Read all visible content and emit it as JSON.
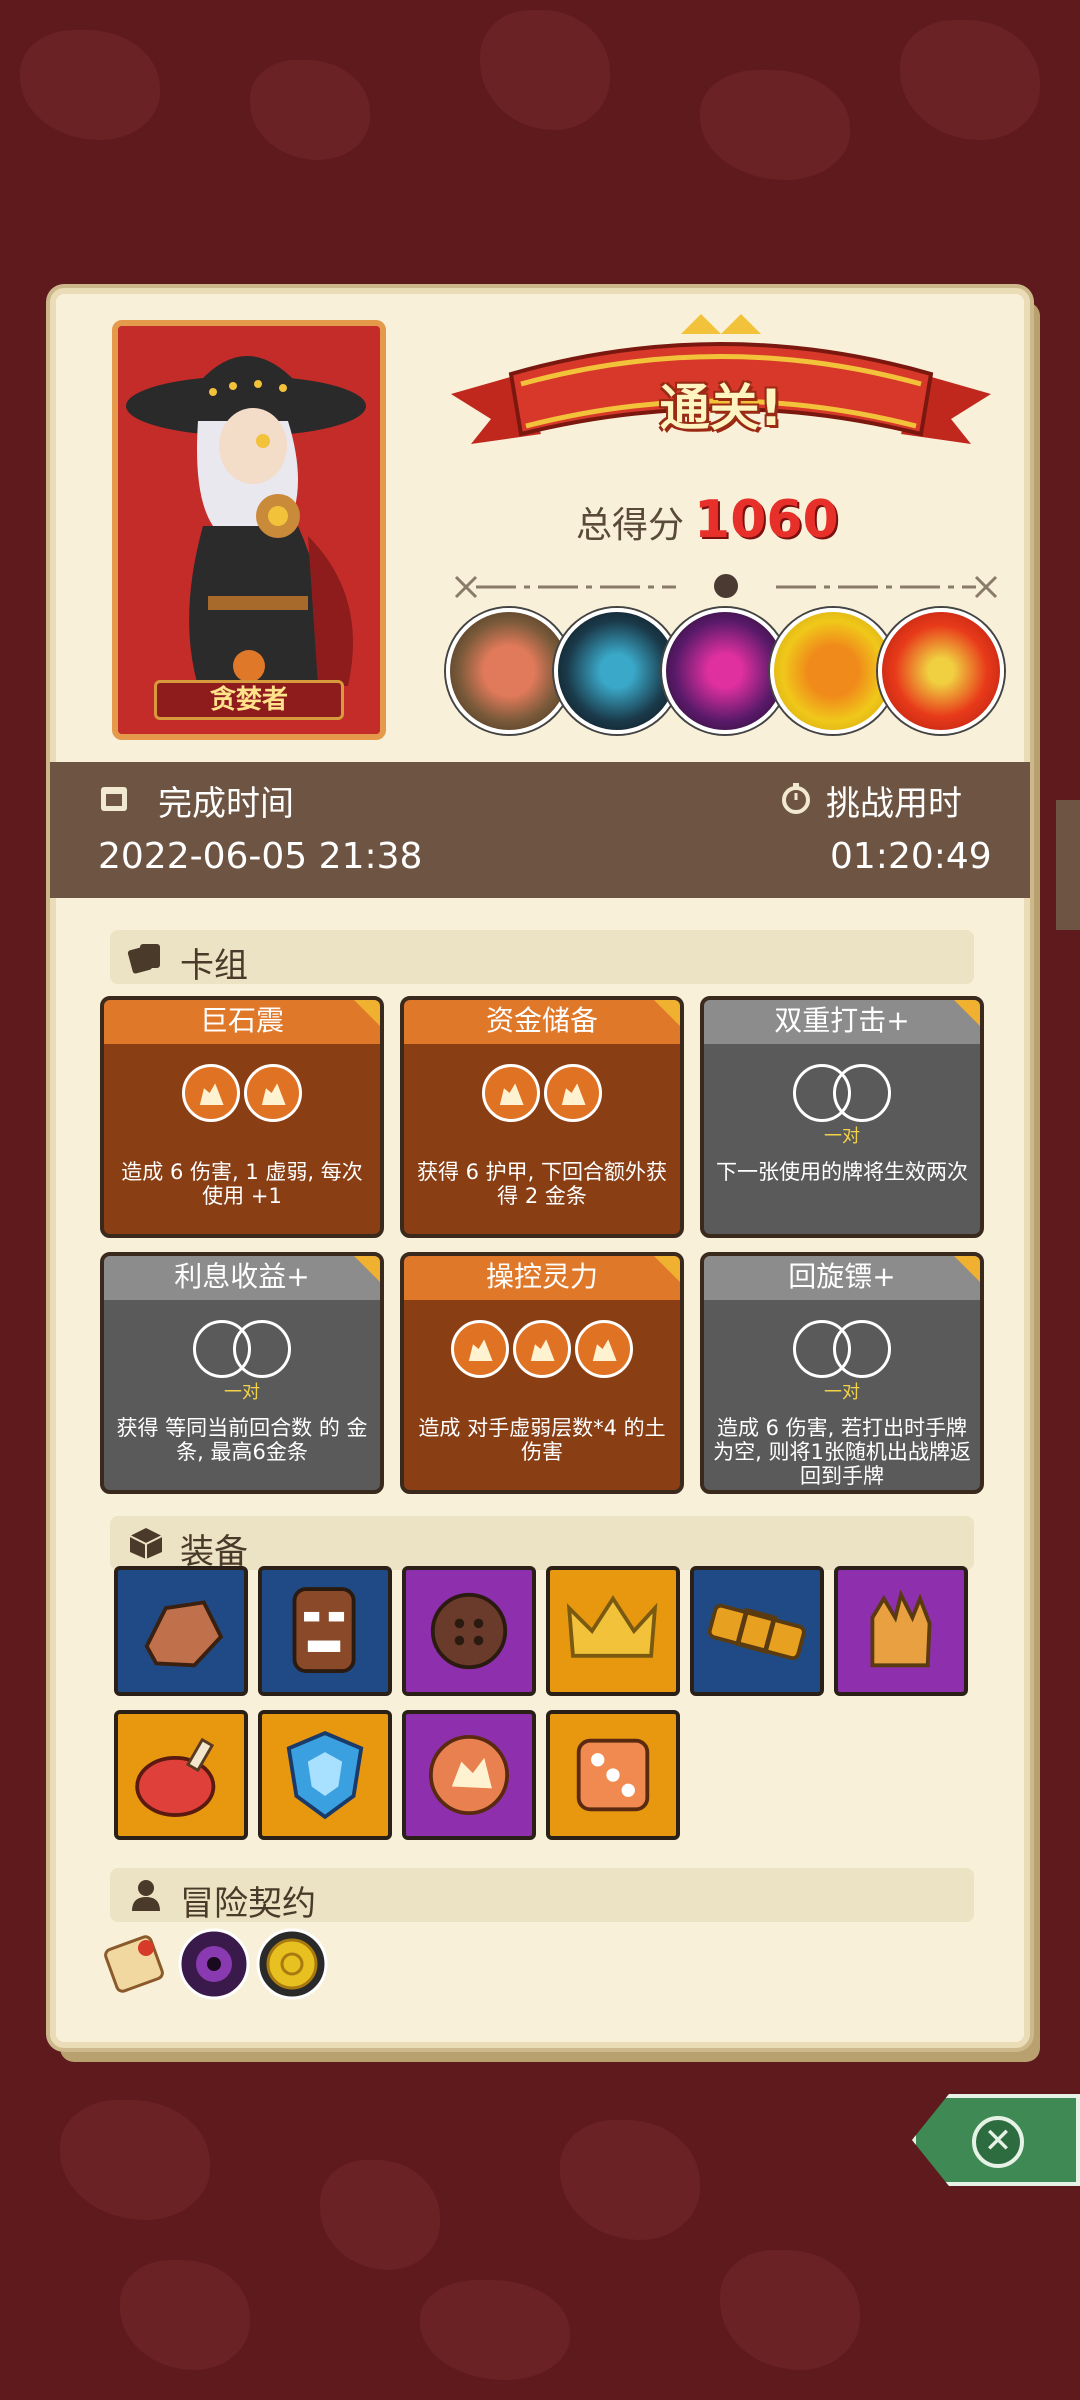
{
  "result": {
    "banner": "通关!",
    "score_label": "总得分",
    "score_value": "1060"
  },
  "character": {
    "name": "贪婪者"
  },
  "time": {
    "finish_label": "完成时间",
    "finish_value": "2022-06-05 21:38",
    "challenge_label": "挑战用时",
    "challenge_value": "01:20:49"
  },
  "deck": {
    "title": "卡组",
    "cards": [
      {
        "title": "巨石震",
        "style": "orange",
        "orbs": 2,
        "desc": "造成 6 伤害, 1 虚弱, 每次使用 +1"
      },
      {
        "title": "资金储备",
        "style": "orange",
        "orbs": 2,
        "desc": "获得 6 护甲, 下回合额外获得 2 金条"
      },
      {
        "title": "双重打击+",
        "style": "gray",
        "orbs": 0,
        "pair": "一对",
        "desc": "下一张使用的牌将生效两次"
      },
      {
        "title": "利息收益+",
        "style": "gray",
        "orbs": 0,
        "pair": "一对",
        "desc": "获得 等同当前回合数 的 金条, 最高6金条"
      },
      {
        "title": "操控灵力",
        "style": "orange",
        "orbs": 3,
        "desc": "造成 对手虚弱层数*4 的土伤害"
      },
      {
        "title": "回旋镖+",
        "style": "gray",
        "orbs": 0,
        "pair": "一对",
        "desc": "造成 6 伤害, 若打出时手牌为空, 则将1张随机出战牌返回到手牌"
      }
    ]
  },
  "equipment": {
    "title": "装备",
    "items": [
      {
        "name": "rock-icon",
        "color": "blue"
      },
      {
        "name": "tiki-mask-icon",
        "color": "blue"
      },
      {
        "name": "button-icon",
        "color": "purple"
      },
      {
        "name": "crown-icon",
        "color": "yellow"
      },
      {
        "name": "belt-icon",
        "color": "blue"
      },
      {
        "name": "glove-icon",
        "color": "purple"
      },
      {
        "name": "ham-icon",
        "color": "yellow"
      },
      {
        "name": "shield-gem-icon",
        "color": "yellow"
      },
      {
        "name": "stone-orb-icon",
        "color": "purple"
      },
      {
        "name": "dice-icon",
        "color": "yellow"
      }
    ]
  },
  "contracts": {
    "title": "冒险契约",
    "items": [
      "scroll-icon",
      "eye-seal-icon",
      "gold-coin-icon"
    ]
  },
  "colors": {
    "accent_red": "#e8302a",
    "background": "#5e1a1c",
    "parchment": "#f8f0d8",
    "strip": "#6e5442",
    "close_green": "#3f8a54"
  }
}
